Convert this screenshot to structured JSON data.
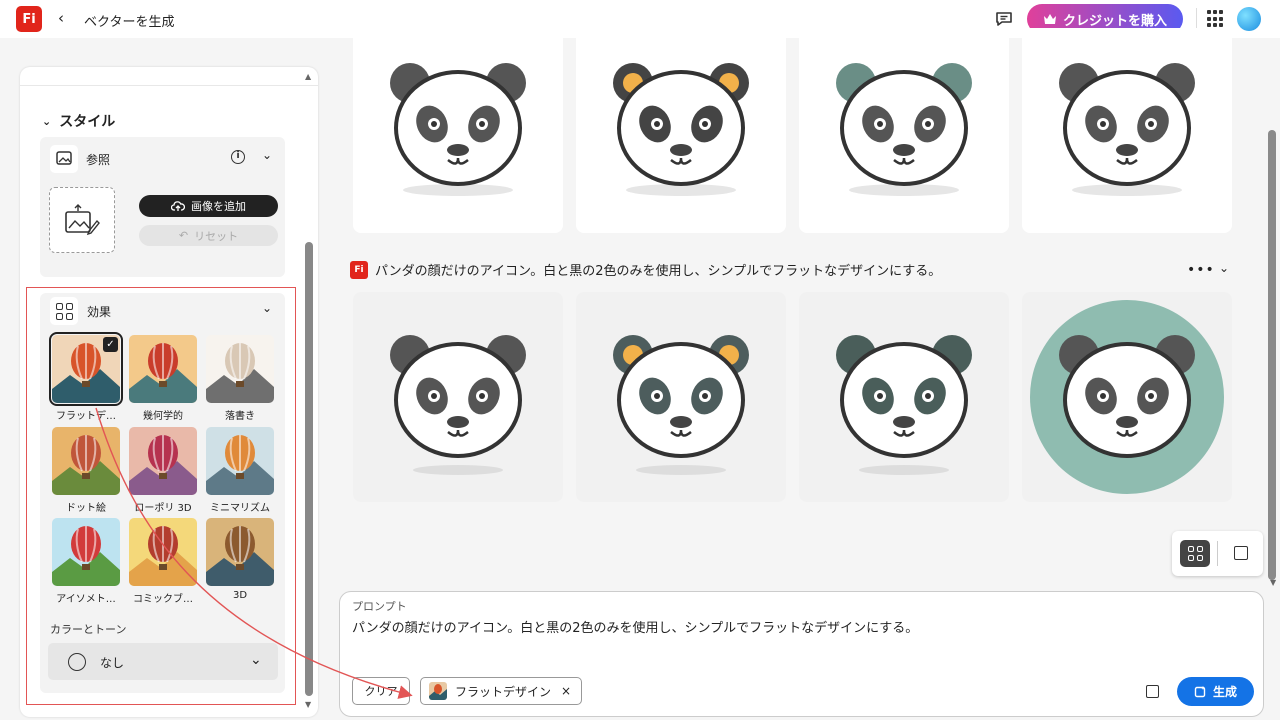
{
  "header": {
    "logo_text": "Fi",
    "back_label": "‹",
    "title": "ベクターを生成",
    "credit_button": "クレジットを購入"
  },
  "left_panel": {
    "style_heading": "スタイル",
    "reference": {
      "label": "参照",
      "add_image": "画像を追加",
      "reset": "リセット"
    },
    "effects": {
      "label": "効果",
      "items": [
        {
          "label": "フラットデ…",
          "selected": true
        },
        {
          "label": "幾何学的",
          "selected": false
        },
        {
          "label": "落書き",
          "selected": false
        },
        {
          "label": "ドット絵",
          "selected": false
        },
        {
          "label": "ローポリ 3D",
          "selected": false
        },
        {
          "label": "ミニマリズム",
          "selected": false
        },
        {
          "label": "アイソメト…",
          "selected": false
        },
        {
          "label": "コミックブ…",
          "selected": false
        },
        {
          "label": "3D",
          "selected": false
        }
      ]
    },
    "color_tone": {
      "label": "カラーとトーン",
      "value": "なし"
    }
  },
  "gallery": {
    "prompt_logo": "Fi",
    "prompt_text": "パンダの顔だけのアイコン。白と黒の2色のみを使用し、シンプルでフラットなデザインにする。",
    "more_label": "•••"
  },
  "prompt_box": {
    "label": "プロンプト",
    "text": "パンダの顔だけのアイコン。白と黒の2色のみを使用し、シンプルでフラットなデザインにする。",
    "clear_button": "クリア",
    "chip_label": "フラットデザイン",
    "chip_close": "×",
    "generate_button": "生成"
  },
  "colors": {
    "accent_blue": "#1473e6",
    "brand_red": "#e1251b",
    "annotation_red": "#e25555"
  }
}
